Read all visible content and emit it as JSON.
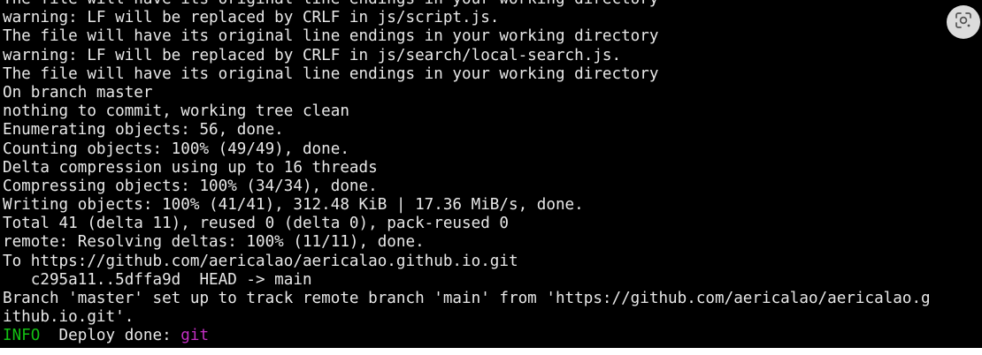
{
  "terminal": {
    "lines": [
      {
        "text": "The file will have its original line endings in your working directory"
      },
      {
        "text": "warning: LF will be replaced by CRLF in js/script.js."
      },
      {
        "text": "The file will have its original line endings in your working directory"
      },
      {
        "text": "warning: LF will be replaced by CRLF in js/search/local-search.js."
      },
      {
        "text": "The file will have its original line endings in your working directory"
      },
      {
        "text": "On branch master"
      },
      {
        "text": "nothing to commit, working tree clean"
      },
      {
        "text": "Enumerating objects: 56, done."
      },
      {
        "text": "Counting objects: 100% (49/49), done."
      },
      {
        "text": "Delta compression using up to 16 threads"
      },
      {
        "text": "Compressing objects: 100% (34/34), done."
      },
      {
        "text": "Writing objects: 100% (41/41), 312.48 KiB | 17.36 MiB/s, done."
      },
      {
        "text": "Total 41 (delta 11), reused 0 (delta 0), pack-reused 0"
      },
      {
        "text": "remote: Resolving deltas: 100% (11/11), done."
      },
      {
        "text": "To https://github.com/aericalao/aericalao.github.io.git"
      },
      {
        "text": "   c295a11..5dffa9d  HEAD -> main"
      },
      {
        "text": "Branch 'master' set up to track remote branch 'main' from 'https://github.com/aericalao/aericalao.g"
      },
      {
        "text": "ithub.io.git'."
      }
    ],
    "last_line": {
      "level": "INFO",
      "message": "  Deploy done: ",
      "target": "git"
    }
  },
  "colors": {
    "background": "#000000",
    "text": "#e8e8e8",
    "info": "#13c013",
    "target": "#c32fc3"
  },
  "icons": {
    "lens": "google-lens-icon"
  }
}
